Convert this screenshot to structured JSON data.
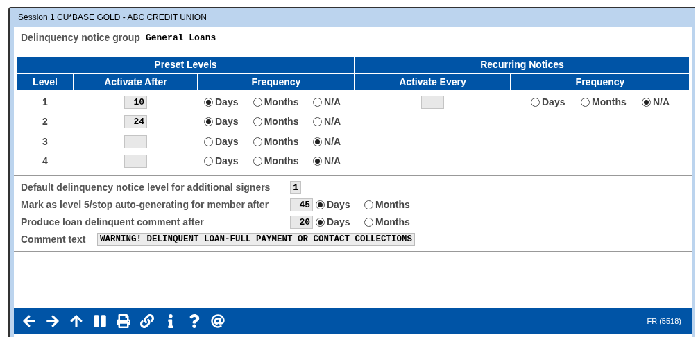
{
  "window": {
    "title": "Session 1 CU*BASE GOLD - ABC CREDIT UNION"
  },
  "group": {
    "label": "Delinquency notice group",
    "value": "General Loans"
  },
  "table": {
    "group_headers": [
      "Preset Levels",
      "Recurring Notices"
    ],
    "columns": [
      "Level",
      "Activate After",
      "Frequency",
      "Activate Every",
      "Frequency"
    ],
    "rows": [
      {
        "level": "1",
        "activate_after": "10",
        "frequency": [
          {
            "label": "Days",
            "selected": true
          },
          {
            "label": "Months",
            "selected": false
          },
          {
            "label": "N/A",
            "selected": false
          }
        ],
        "recurring": {
          "frequency": [
            {
              "label": "Days",
              "selected": false
            },
            {
              "label": "Months",
              "selected": false
            },
            {
              "label": "N/A",
              "selected": true
            }
          ]
        }
      },
      {
        "level": "2",
        "activate_after": "24",
        "frequency": [
          {
            "label": "Days",
            "selected": true
          },
          {
            "label": "Months",
            "selected": false
          },
          {
            "label": "N/A",
            "selected": false
          }
        ]
      },
      {
        "level": "3",
        "frequency": [
          {
            "label": "Days",
            "selected": false
          },
          {
            "label": "Months",
            "selected": false
          },
          {
            "label": "N/A",
            "selected": true
          }
        ]
      },
      {
        "level": "4",
        "frequency": [
          {
            "label": "Days",
            "selected": false
          },
          {
            "label": "Months",
            "selected": false
          },
          {
            "label": "N/A",
            "selected": true
          }
        ]
      }
    ]
  },
  "settings": [
    {
      "kind": "value",
      "label": "Default delinquency notice level for additional signers",
      "value": "1"
    },
    {
      "kind": "period",
      "label": "Mark as level 5/stop auto-generating for member after",
      "value": "45",
      "options": [
        {
          "label": "Days",
          "selected": true
        },
        {
          "label": "Months",
          "selected": false
        }
      ]
    },
    {
      "kind": "period",
      "label": "Produce loan delinquent comment after",
      "value": "20",
      "options": [
        {
          "label": "Days",
          "selected": true
        },
        {
          "label": "Months",
          "selected": false
        }
      ]
    },
    {
      "kind": "text",
      "label": "Comment text",
      "value": "WARNING! DELINQUENT LOAN-FULL PAYMENT OR CONTACT COLLECTIONS"
    }
  ],
  "status_bar": {
    "code": "FR (5518)"
  }
}
